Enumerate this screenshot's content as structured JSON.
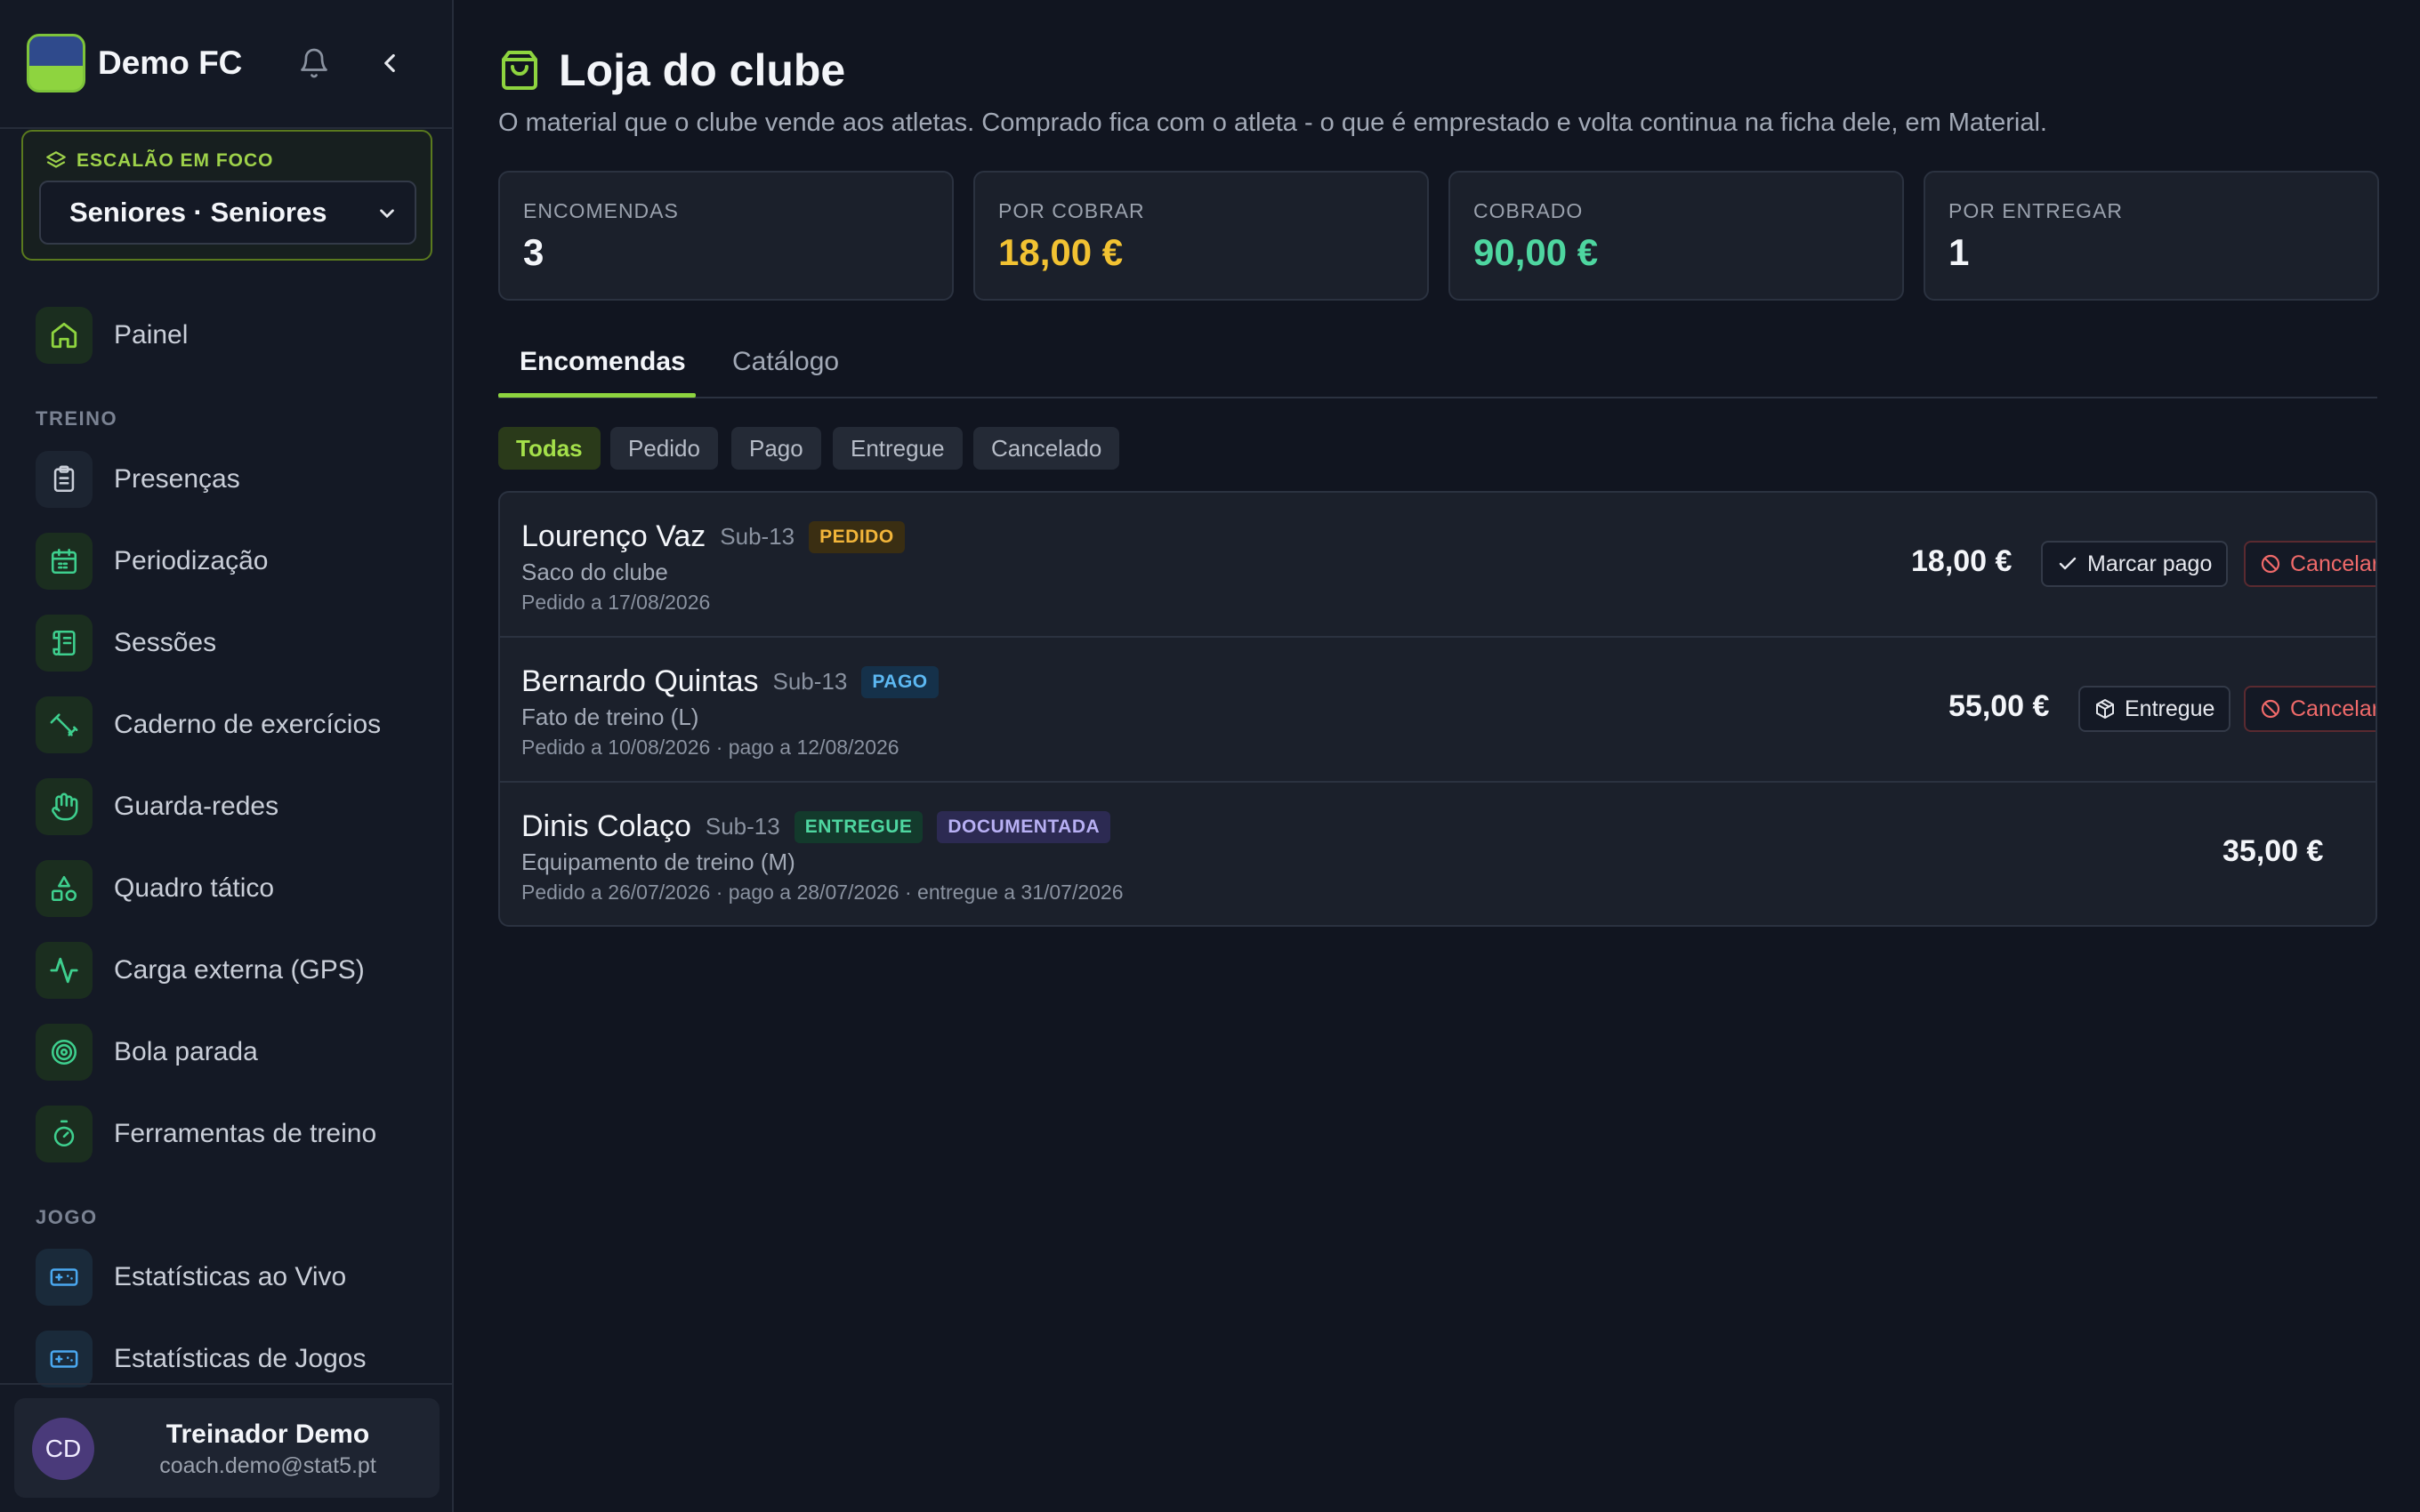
{
  "club": {
    "name": "Demo FC"
  },
  "focus": {
    "label": "ESCALÃO EM FOCO",
    "selected": "Seniores · Seniores"
  },
  "nav": {
    "painel": "Painel",
    "section_treino": "TREINO",
    "treino": [
      "Presenças",
      "Periodização",
      "Sessões",
      "Caderno de exercícios",
      "Guarda-redes",
      "Quadro tático",
      "Carga externa (GPS)",
      "Bola parada",
      "Ferramentas de treino"
    ],
    "section_jogo": "JOGO",
    "jogo": [
      "Estatísticas ao Vivo",
      "Estatísticas de Jogos"
    ]
  },
  "user": {
    "initials": "CD",
    "name": "Treinador Demo",
    "email": "coach.demo@stat5.pt"
  },
  "page": {
    "title": "Loja do clube",
    "subtitle": "O material que o clube vende aos atletas. Comprado fica com o atleta - o que é emprestado e volta continua na ficha dele, em Material."
  },
  "stats": [
    {
      "label": "ENCOMENDAS",
      "value": "3",
      "color": "#f3f5f9"
    },
    {
      "label": "POR COBRAR",
      "value": "18,00 €",
      "color": "#f2c232"
    },
    {
      "label": "COBRADO",
      "value": "90,00 €",
      "color": "#4ed6a0"
    },
    {
      "label": "POR ENTREGAR",
      "value": "1",
      "color": "#f3f5f9"
    }
  ],
  "tabs": [
    "Encomendas",
    "Catálogo"
  ],
  "filters": [
    "Todas",
    "Pedido",
    "Pago",
    "Entregue",
    "Cancelado"
  ],
  "orders": [
    {
      "name": "Lourenço Vaz",
      "team": "Sub-13",
      "status": "PEDIDO",
      "item": "Saco do clube",
      "dates": "Pedido a 17/08/2026",
      "price": "18,00 €",
      "action": "Marcar pago",
      "cancel": "Cancelar"
    },
    {
      "name": "Bernardo Quintas",
      "team": "Sub-13",
      "status": "PAGO",
      "item": "Fato de treino (L)",
      "dates": "Pedido a 10/08/2026 · pago a 12/08/2026",
      "price": "55,00 €",
      "action": "Entregue",
      "cancel": "Cancelar"
    },
    {
      "name": "Dinis Colaço",
      "team": "Sub-13",
      "status": "ENTREGUE",
      "extra_badge": "DOCUMENTADA",
      "item": "Equipamento de treino (M)",
      "dates": "Pedido a 26/07/2026 · pago a 28/07/2026 · entregue a 31/07/2026",
      "price": "35,00 €"
    }
  ]
}
